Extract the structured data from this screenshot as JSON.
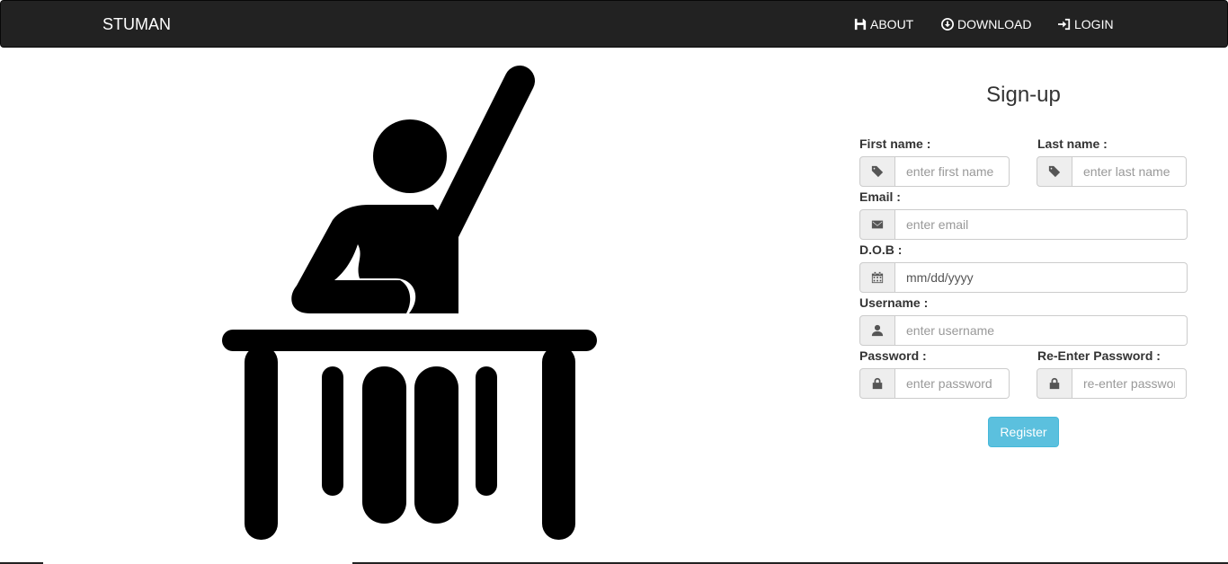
{
  "nav": {
    "brand": "STUMAN",
    "links": [
      {
        "label": "ABOUT",
        "icon": "floppy-disk-icon"
      },
      {
        "label": "DOWNLOAD",
        "icon": "download-circle-icon"
      },
      {
        "label": "LOGIN",
        "icon": "log-in-icon"
      }
    ]
  },
  "hero": {
    "icon": "student-raising-hand-icon"
  },
  "form": {
    "title": "Sign-up",
    "first_name": {
      "label": "First name :",
      "placeholder": "enter first name",
      "icon": "tag-icon"
    },
    "last_name": {
      "label": "Last name :",
      "placeholder": "enter last name",
      "icon": "tag-icon"
    },
    "email": {
      "label": "Email :",
      "placeholder": "enter email",
      "icon": "envelope-icon"
    },
    "dob": {
      "label": "D.O.B :",
      "value": "mm/dd/yyyy",
      "icon": "calendar-icon"
    },
    "username": {
      "label": "Username :",
      "placeholder": "enter username",
      "icon": "user-icon"
    },
    "password": {
      "label": "Password :",
      "placeholder": "enter password",
      "icon": "lock-icon"
    },
    "reenter_password": {
      "label": "Re-Enter Password :",
      "placeholder": "re-enter password",
      "icon": "lock-icon"
    },
    "register_label": "Register"
  },
  "colors": {
    "navbar": "#222222",
    "button": "#5bc0de",
    "addon": "#eeeeee"
  }
}
